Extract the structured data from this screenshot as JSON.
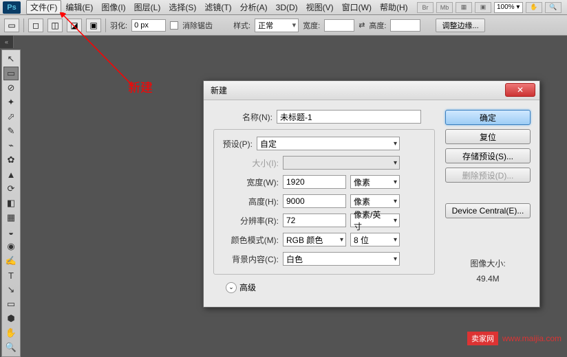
{
  "menubar": {
    "items": [
      "文件(F)",
      "编辑(E)",
      "图像(I)",
      "图层(L)",
      "选择(S)",
      "滤镜(T)",
      "分析(A)",
      "3D(D)",
      "视图(V)",
      "窗口(W)",
      "帮助(H)"
    ],
    "right_icons": [
      "Br",
      "Mb",
      "▦",
      "▣"
    ],
    "zoom": "100% ▾"
  },
  "optbar": {
    "feather_label": "羽化:",
    "feather_value": "0 px",
    "antialias": "消除锯齿",
    "style_label": "样式:",
    "style_value": "正常",
    "width_label": "宽度:",
    "height_label": "高度:",
    "refine": "调整边缘..."
  },
  "annotation": "新建",
  "dialog": {
    "title": "新建",
    "name_label": "名称(N):",
    "name_value": "未标题-1",
    "preset_label": "预设(P):",
    "preset_value": "自定",
    "size_label": "大小(I):",
    "width_label": "宽度(W):",
    "width_value": "1920",
    "width_unit": "像素",
    "height_label": "高度(H):",
    "height_value": "9000",
    "height_unit": "像素",
    "res_label": "分辨率(R):",
    "res_value": "72",
    "res_unit": "像素/英寸",
    "color_label": "颜色模式(M):",
    "color_value": "RGB 颜色",
    "bit_value": "8 位",
    "bg_label": "背景内容(C):",
    "bg_value": "白色",
    "advanced": "高级",
    "ok": "确定",
    "reset": "复位",
    "save_preset": "存储预设(S)...",
    "delete_preset": "删除预设(D)...",
    "device_central": "Device Central(E)...",
    "imgsize_label": "图像大小:",
    "imgsize_value": "49.4M"
  },
  "tools": [
    "↖",
    "▭",
    "⊘",
    "✦",
    "⬀",
    "✎",
    "↗",
    "⌁",
    "◐",
    "⊕",
    "✿",
    "⟋",
    "◧",
    "✑",
    "◒",
    "◉",
    "⊘",
    "✍",
    "T",
    "↘",
    "▭",
    "✋",
    "🔍"
  ],
  "watermark": {
    "badge": "卖家网",
    "url": "www.maijia.com"
  }
}
